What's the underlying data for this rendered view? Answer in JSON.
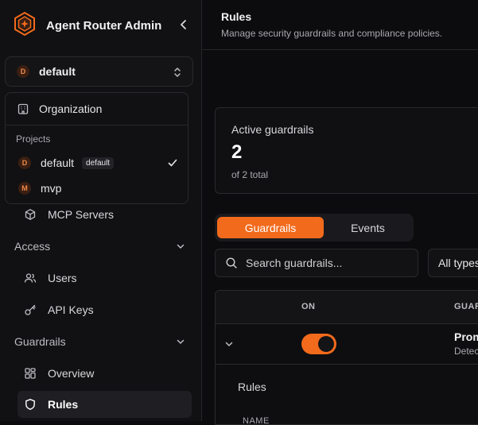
{
  "app": {
    "title": "Agent Router Admin"
  },
  "project_selector": {
    "avatar": "D",
    "current": "default"
  },
  "dropdown": {
    "organization_label": "Organization",
    "projects_heading": "Projects",
    "projects": [
      {
        "avatar": "D",
        "name": "default",
        "badge": "default",
        "selected": true
      },
      {
        "avatar": "M",
        "name": "mvp",
        "badge": "",
        "selected": false
      }
    ]
  },
  "nav": {
    "mcp_servers": "MCP Servers",
    "access_section": "Access",
    "users": "Users",
    "api_keys": "API Keys",
    "guardrails_section": "Guardrails",
    "overview": "Overview",
    "rules": "Rules"
  },
  "header": {
    "title": "Rules",
    "subtitle": "Manage security guardrails and compliance policies."
  },
  "stats": {
    "label": "Active guardrails",
    "value": "2",
    "sub": "of 2 total"
  },
  "tabs": {
    "guardrails": "Guardrails",
    "events": "Events"
  },
  "search": {
    "placeholder": "Search guardrails..."
  },
  "type_filter": {
    "label": "All types"
  },
  "table": {
    "columns": {
      "on": "ON",
      "guardrail": "GUARDRAIL"
    },
    "rows": [
      {
        "name": "Prompt",
        "description": "Detects",
        "enabled": true
      }
    ],
    "expanded": {
      "label": "Rules",
      "column": "NAME"
    }
  },
  "colors": {
    "accent": "#f26a1b",
    "background": "#0c0c0e",
    "sidebar": "#111113"
  },
  "icons": {
    "logo": "hexagon-logo-icon",
    "collapse": "chevron-left-icon",
    "selector": "chevron-up-down-icon",
    "organization": "building-icon",
    "check": "check-icon",
    "mcp_servers": "cube-icon",
    "users": "users-icon",
    "api_keys": "key-icon",
    "overview": "grid-icon",
    "rules": "shield-icon",
    "search": "search-icon",
    "expand": "chevron-down-icon"
  }
}
